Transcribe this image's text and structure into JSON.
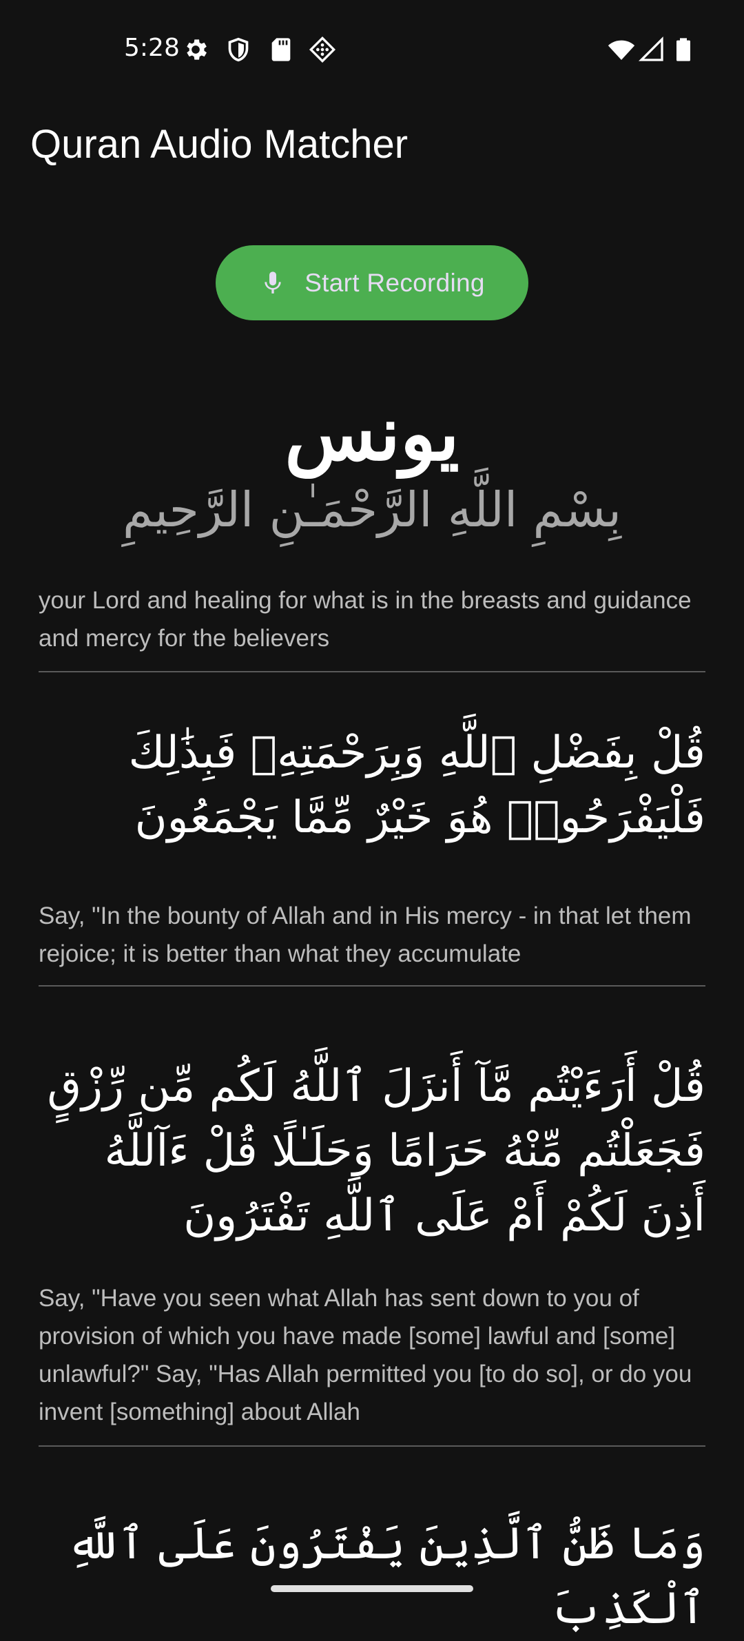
{
  "status_bar": {
    "time": "5:28",
    "left_icons": [
      "settings-gear-icon",
      "shield-icon",
      "sd-card-icon",
      "diamond-grid-icon"
    ],
    "right_icons": [
      "wifi-icon",
      "cellular-signal-icon",
      "battery-icon"
    ]
  },
  "app_bar": {
    "title": "Quran Audio Matcher"
  },
  "record_button": {
    "label": "Start Recording",
    "icon": "microphone-icon",
    "color": "#4caf50"
  },
  "surah": {
    "name": "يونس",
    "basmala": "بِسْمِ اللَّهِ الرَّحْمَـٰنِ الرَّحِيمِ"
  },
  "verses": [
    {
      "arabic": "",
      "translation": "your Lord and healing for what is in the breasts and guidance and mercy for the believers"
    },
    {
      "arabic": "قُلْ بِفَضْلِ ٱللَّهِ وَبِرَحْمَتِهِۦ فَبِذَٰلِكَ فَلْيَفْرَحُوا۟ هُوَ خَيْرٌ مِّمَّا يَجْمَعُونَ",
      "translation": "Say, \"In the bounty of Allah and in His mercy - in that let them rejoice; it is better than what they accumulate"
    },
    {
      "arabic": "قُلْ أَرَءَيْتُم مَّآ أَنزَلَ ٱللَّهُ لَكُم مِّن رِّزْقٍ فَجَعَلْتُم مِّنْهُ حَرَامًا وَحَلَـٰلًا قُلْ ءَآللَّهُ أَذِنَ لَكُمْ أَمْ عَلَى ٱللَّهِ تَفْتَرُونَ",
      "translation": "Say, \"Have you seen what Allah has sent down to you of provision of which you have made [some] lawful and [some] unlawful?\" Say, \"Has Allah permitted you [to do so], or do you invent [something] about Allah"
    },
    {
      "arabic": "وَمَا ظَنُّ ٱلَّذِينَ يَفْتَرُونَ عَلَى ٱللَّهِ ٱلْكَذِبَ",
      "translation": ""
    }
  ]
}
